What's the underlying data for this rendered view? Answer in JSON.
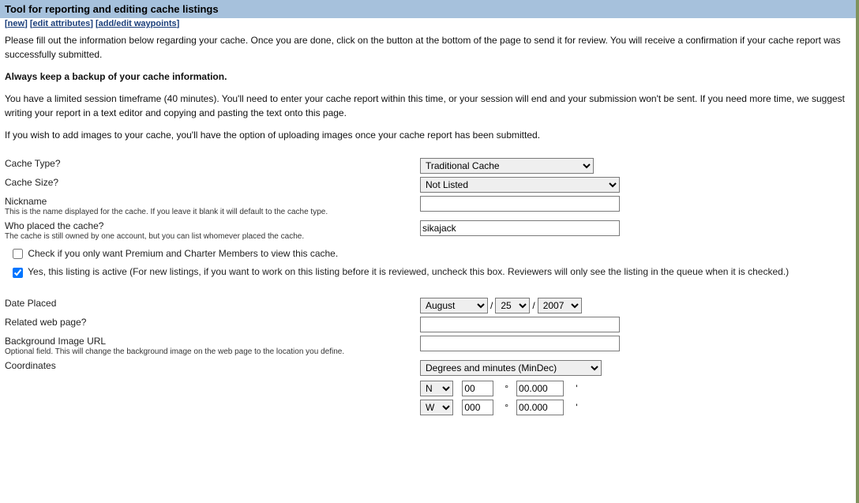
{
  "header": {
    "title": "Tool for reporting and editing cache listings"
  },
  "nav": {
    "new": "new",
    "edit_attributes": "edit attributes",
    "add_edit_waypoints": "add/edit waypoints"
  },
  "intro": {
    "p1": "Please fill out the information below regarding your cache. Once you are done, click on the button at the bottom of the page to send it for review. You will receive a confirmation if your cache report was successfully submitted.",
    "bold": "Always keep a backup of your cache information.",
    "p2": "You have a limited session timeframe (40 minutes). You'll need to enter your cache report within this time, or your session will end and your submission won't be sent. If you need more time, we suggest writing your report in a text editor and copying and pasting the text onto this page.",
    "p3": "If you wish to add images to your cache, you'll have the option of uploading images once your cache report has been submitted."
  },
  "form": {
    "cache_type": {
      "label": "Cache Type?",
      "value": "Traditional Cache"
    },
    "cache_size": {
      "label": "Cache Size?",
      "value": "Not Listed"
    },
    "nickname": {
      "label": "Nickname",
      "sub": "This is the name displayed for the cache. If you leave it blank it will default to the cache type.",
      "value": ""
    },
    "placed_by": {
      "label": "Who placed the cache?",
      "sub": "The cache is still owned by one account, but you can list whomever placed the cache.",
      "value": "sikajack"
    },
    "premium_only": {
      "label": "Check if you only want Premium and Charter Members to view this cache.",
      "checked": false
    },
    "active": {
      "label": "Yes, this listing is active (For new listings, if you want to work on this listing before it is reviewed, uncheck this box. Reviewers will only see the listing in the queue when it is checked.)",
      "checked": true
    },
    "date_placed": {
      "label": "Date Placed",
      "month": "August",
      "day": "25",
      "year": "2007"
    },
    "related_url": {
      "label": "Related web page?",
      "value": ""
    },
    "bg_image": {
      "label": "Background Image URL",
      "sub": "Optional field. This will change the background image on the web page to the location you define.",
      "value": ""
    },
    "coordinates": {
      "label": "Coordinates",
      "format": "Degrees and minutes (MinDec)",
      "lat_hemi": "N",
      "lat_deg": "00",
      "lat_min": "00.000",
      "lon_hemi": "W",
      "lon_deg": "000",
      "lon_min": "00.000",
      "deg_symbol": "°",
      "min_symbol": "'"
    }
  }
}
